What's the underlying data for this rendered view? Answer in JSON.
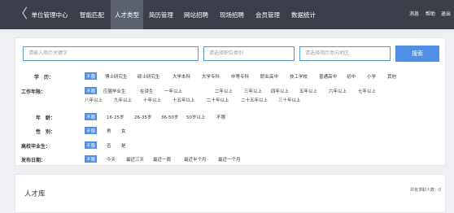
{
  "topbar": {
    "back_glyph": "〈",
    "nav": [
      "单位管理中心",
      "智能匹配",
      "人才类型",
      "简历管理",
      "网站招聘",
      "现场招聘",
      "会员管理",
      "数据统计"
    ],
    "active_index": 2,
    "right": [
      "消息",
      "帮助",
      "退出"
    ]
  },
  "search": {
    "keyword_placeholder": "请输入简历关键字",
    "position_placeholder": "请选择职位类别",
    "region_placeholder": "请选择简历意向地区",
    "button": "搜索"
  },
  "filters": {
    "education": {
      "label": "学　历：",
      "all": "不限",
      "options": [
        "博士研究生",
        "硕士研究生",
        "大学本科",
        "大学专科",
        "中等专科",
        "职业高中",
        "技工学校",
        "普通高中",
        "初中",
        "小学",
        "其他"
      ]
    },
    "experience": {
      "label": "工作年限：",
      "all": "不限",
      "options": [
        "应届毕业生",
        "在读生",
        "一年以上",
        "二年以上",
        "三年以上",
        "四年以上",
        "五年以上",
        "六年以上",
        "七年以上",
        "八年以上",
        "九年以上",
        "十年以上",
        "十五年以上",
        "二十年以上",
        "二十五年以上",
        "三十年以上"
      ]
    },
    "age": {
      "label": "年　龄：",
      "all": "不限",
      "options": [
        "16-25岁",
        "26-35岁",
        "36-50岁",
        "50岁以上",
        "不限"
      ]
    },
    "gender": {
      "label": "性　别：",
      "all": "不限",
      "options": [
        "男",
        "女"
      ]
    },
    "graduate": {
      "label": "高校毕业生：",
      "all": "不限",
      "options": [
        "否",
        "是"
      ]
    },
    "post_date": {
      "label": "发布日期：",
      "all": "不限",
      "options": [
        "今天",
        "最近三天",
        "最近一周",
        "最近半个月",
        "最近一个月"
      ]
    }
  },
  "library": {
    "title": "人才库",
    "total_label": "共有求职人数：",
    "total_value": "0"
  }
}
